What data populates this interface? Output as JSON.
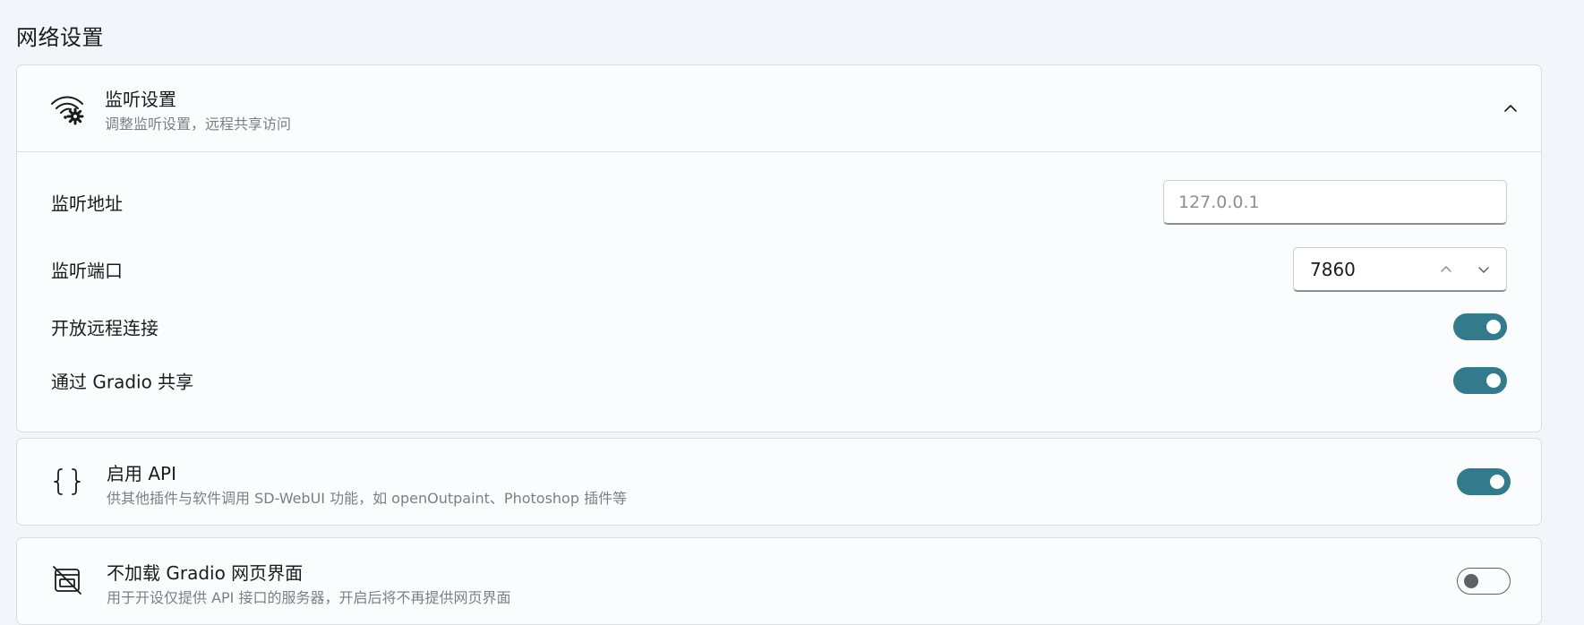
{
  "section_title": "网络设置",
  "listen_card": {
    "icon": "wifi-gear-icon",
    "title": "监听设置",
    "subtitle": "调整监听设置，远程共享访问",
    "expanded": true,
    "rows": {
      "address": {
        "label": "监听地址",
        "value": "",
        "placeholder": "127.0.0.1"
      },
      "port": {
        "label": "监听端口",
        "value": "7860"
      },
      "remote": {
        "label": "开放远程连接",
        "enabled": true
      },
      "gradio_share": {
        "label": "通过 Gradio 共享",
        "enabled": true
      }
    }
  },
  "api_card": {
    "icon": "braces-icon",
    "title": "启用 API",
    "subtitle": "供其他插件与软件调用 SD-WebUI 功能，如 openOutpaint、Photoshop 插件等",
    "enabled": true
  },
  "no_gradio_card": {
    "icon": "no-webpage-icon",
    "title": "不加载 Gradio 网页界面",
    "subtitle": "用于开设仅提供 API 接口的服务器，开启后将不再提供网页界面",
    "enabled": false
  },
  "colors": {
    "accent": "#337a8c",
    "background": "#f2f5f9",
    "card": "#fbfcfd"
  }
}
